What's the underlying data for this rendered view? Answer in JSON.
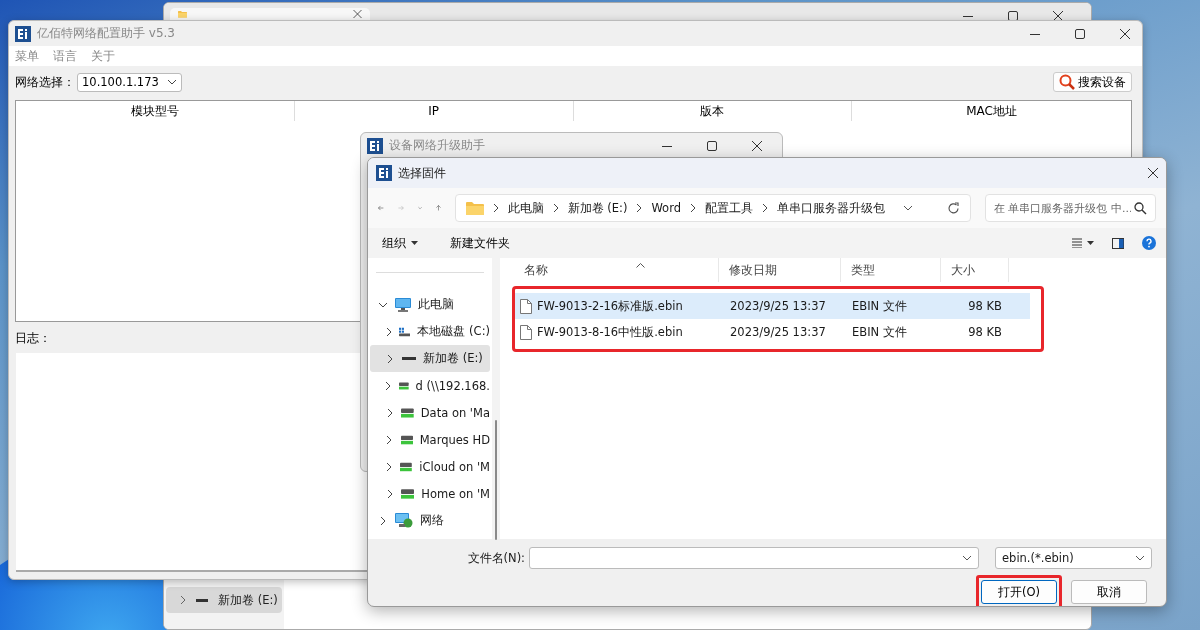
{
  "back_window": {
    "sidebar_items": [
      {
        "label": "新加卷 (E:)",
        "selected": true
      }
    ]
  },
  "main_window": {
    "title": "亿佰特网络配置助手 v5.3",
    "menu": [
      "菜单",
      "语言",
      "关于"
    ],
    "network_label": "网络选择：",
    "network_value": "10.100.1.173",
    "search_button": "搜索设备",
    "table": {
      "columns": [
        "模块型号",
        "IP",
        "版本",
        "MAC地址"
      ]
    },
    "log_label": "日志："
  },
  "upgrade_window": {
    "title": "设备网络升级助手"
  },
  "file_dialog": {
    "title": "选择固件",
    "breadcrumbs": [
      "此电脑",
      "新加卷 (E:)",
      "Word",
      "配置工具",
      "单串口服务器升级包"
    ],
    "search": {
      "placeholder": "在 单串口服务器升级包 中..."
    },
    "toolbar": [
      {
        "label": "组织",
        "kind": "menu"
      },
      {
        "label": "新建文件夹",
        "kind": "button"
      }
    ],
    "nav_tree": [
      {
        "label": "此电脑",
        "kind": "pc",
        "expanded": true,
        "selected": false,
        "children": [
          {
            "label": "本地磁盘 (C:)",
            "kind": "local-disk",
            "expanded": false,
            "selected": false
          },
          {
            "label": "新加卷 (E:)",
            "kind": "drive",
            "expanded": false,
            "selected": true
          },
          {
            "label": "d (\\\\192.168.",
            "kind": "network-drive",
            "expanded": false,
            "selected": false
          },
          {
            "label": "Data on 'Ma",
            "kind": "network-drive",
            "expanded": false,
            "selected": false
          },
          {
            "label": "Marques HD",
            "kind": "network-drive",
            "expanded": false,
            "selected": false
          },
          {
            "label": "iCloud on 'M",
            "kind": "network-drive",
            "expanded": false,
            "selected": false
          },
          {
            "label": "Home on 'M",
            "kind": "network-drive",
            "expanded": false,
            "selected": false
          }
        ]
      },
      {
        "label": "网络",
        "kind": "network",
        "expanded": false,
        "selected": false
      }
    ],
    "columns": [
      "名称",
      "修改日期",
      "类型",
      "大小"
    ],
    "files_outlined": true,
    "files": [
      {
        "name": "FW-9013-2-16标准版.ebin",
        "modified": "2023/9/25 13:37",
        "type": "EBIN 文件",
        "size": "98 KB",
        "selected": true
      },
      {
        "name": "FW-9013-8-16中性版.ebin",
        "modified": "2023/9/25 13:37",
        "type": "EBIN 文件",
        "size": "98 KB",
        "selected": false
      }
    ],
    "filename_label": "文件名(N):",
    "filter": "ebin.(*.ebin)",
    "buttons": [
      {
        "label": "打开(O)",
        "outlined": true
      },
      {
        "label": "取消",
        "outlined": false
      }
    ]
  }
}
